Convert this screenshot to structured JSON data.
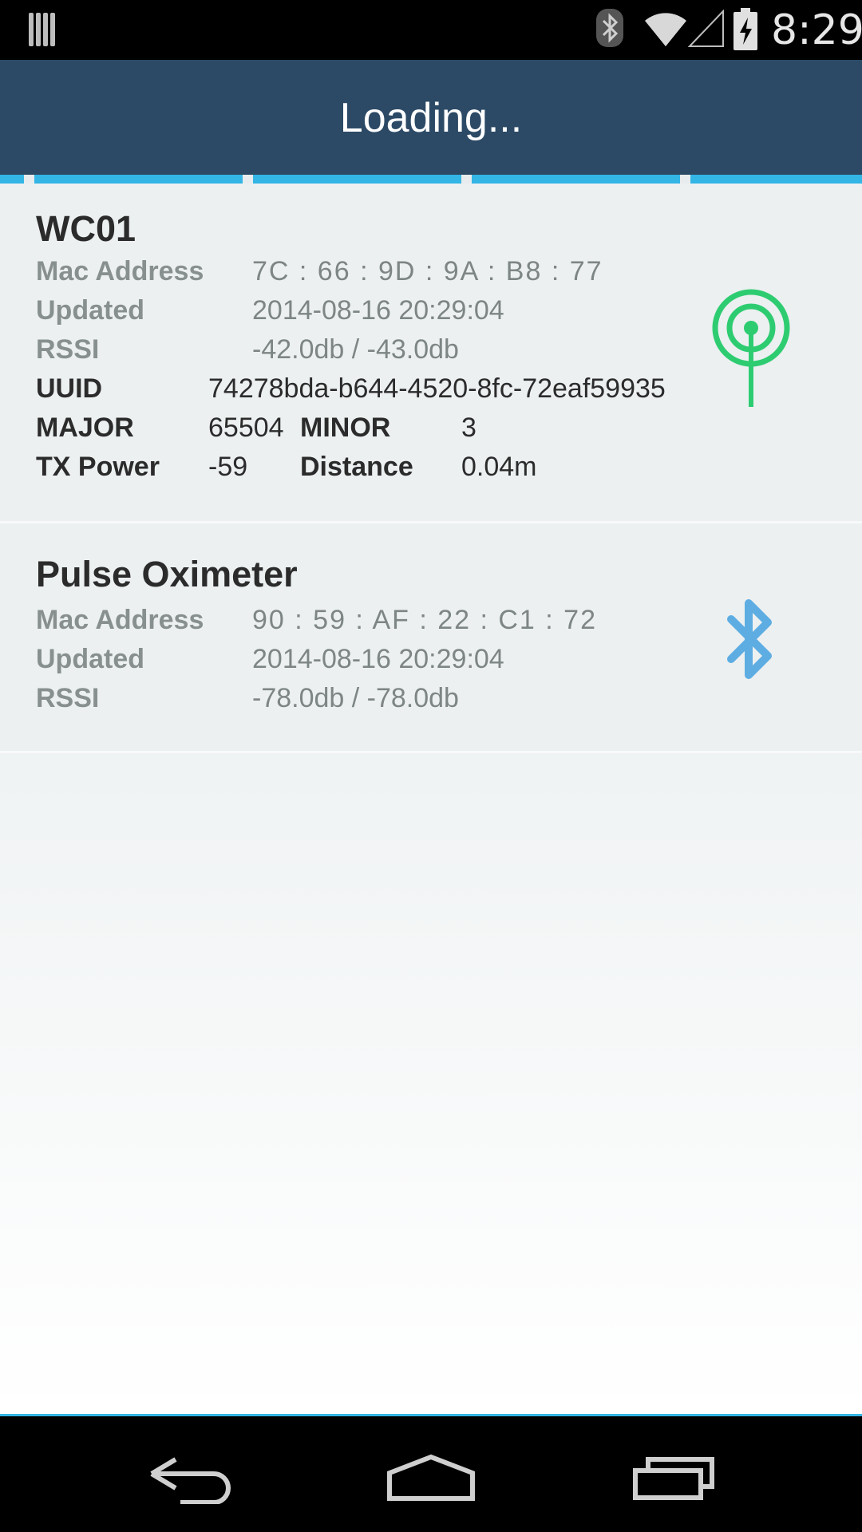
{
  "status_bar": {
    "time": "8:29",
    "icons": [
      "notification-icon",
      "bluetooth-icon",
      "wifi-icon",
      "cell-signal-icon",
      "battery-charging-icon"
    ]
  },
  "action_bar": {
    "title": "Loading..."
  },
  "devices": [
    {
      "name": "WC01",
      "icon": "beacon-antenna-icon",
      "mac_label": "Mac Address",
      "mac_value": "7C : 66 : 9D : 9A : B8 : 77",
      "updated_label": "Updated",
      "updated_value": "2014-08-16 20:29:04",
      "rssi_label": "RSSI",
      "rssi_value": "-42.0db / -43.0db",
      "uuid_label": "UUID",
      "uuid_value": "74278bda-b644-4520-8fc-72eaf59935",
      "major_label": "MAJOR",
      "major_value": "65504",
      "minor_label": "MINOR",
      "minor_value": "3",
      "tx_label": "TX Power",
      "tx_value": "-59",
      "distance_label": "Distance",
      "distance_value": "0.04m"
    },
    {
      "name": "Pulse Oximeter",
      "icon": "bluetooth-icon",
      "mac_label": "Mac Address",
      "mac_value": "90 : 59 : AF : 22 : C1 : 72",
      "updated_label": "Updated",
      "updated_value": "2014-08-16 20:29:04",
      "rssi_label": "RSSI",
      "rssi_value": "-78.0db / -78.0db"
    }
  ],
  "nav_bar": {
    "buttons": [
      "back-icon",
      "home-icon",
      "recents-icon"
    ]
  },
  "colors": {
    "action_bar": "#2c4a66",
    "accent": "#33b5e5",
    "beacon_icon": "#2ecc71",
    "bluetooth_icon": "#5dade2"
  }
}
